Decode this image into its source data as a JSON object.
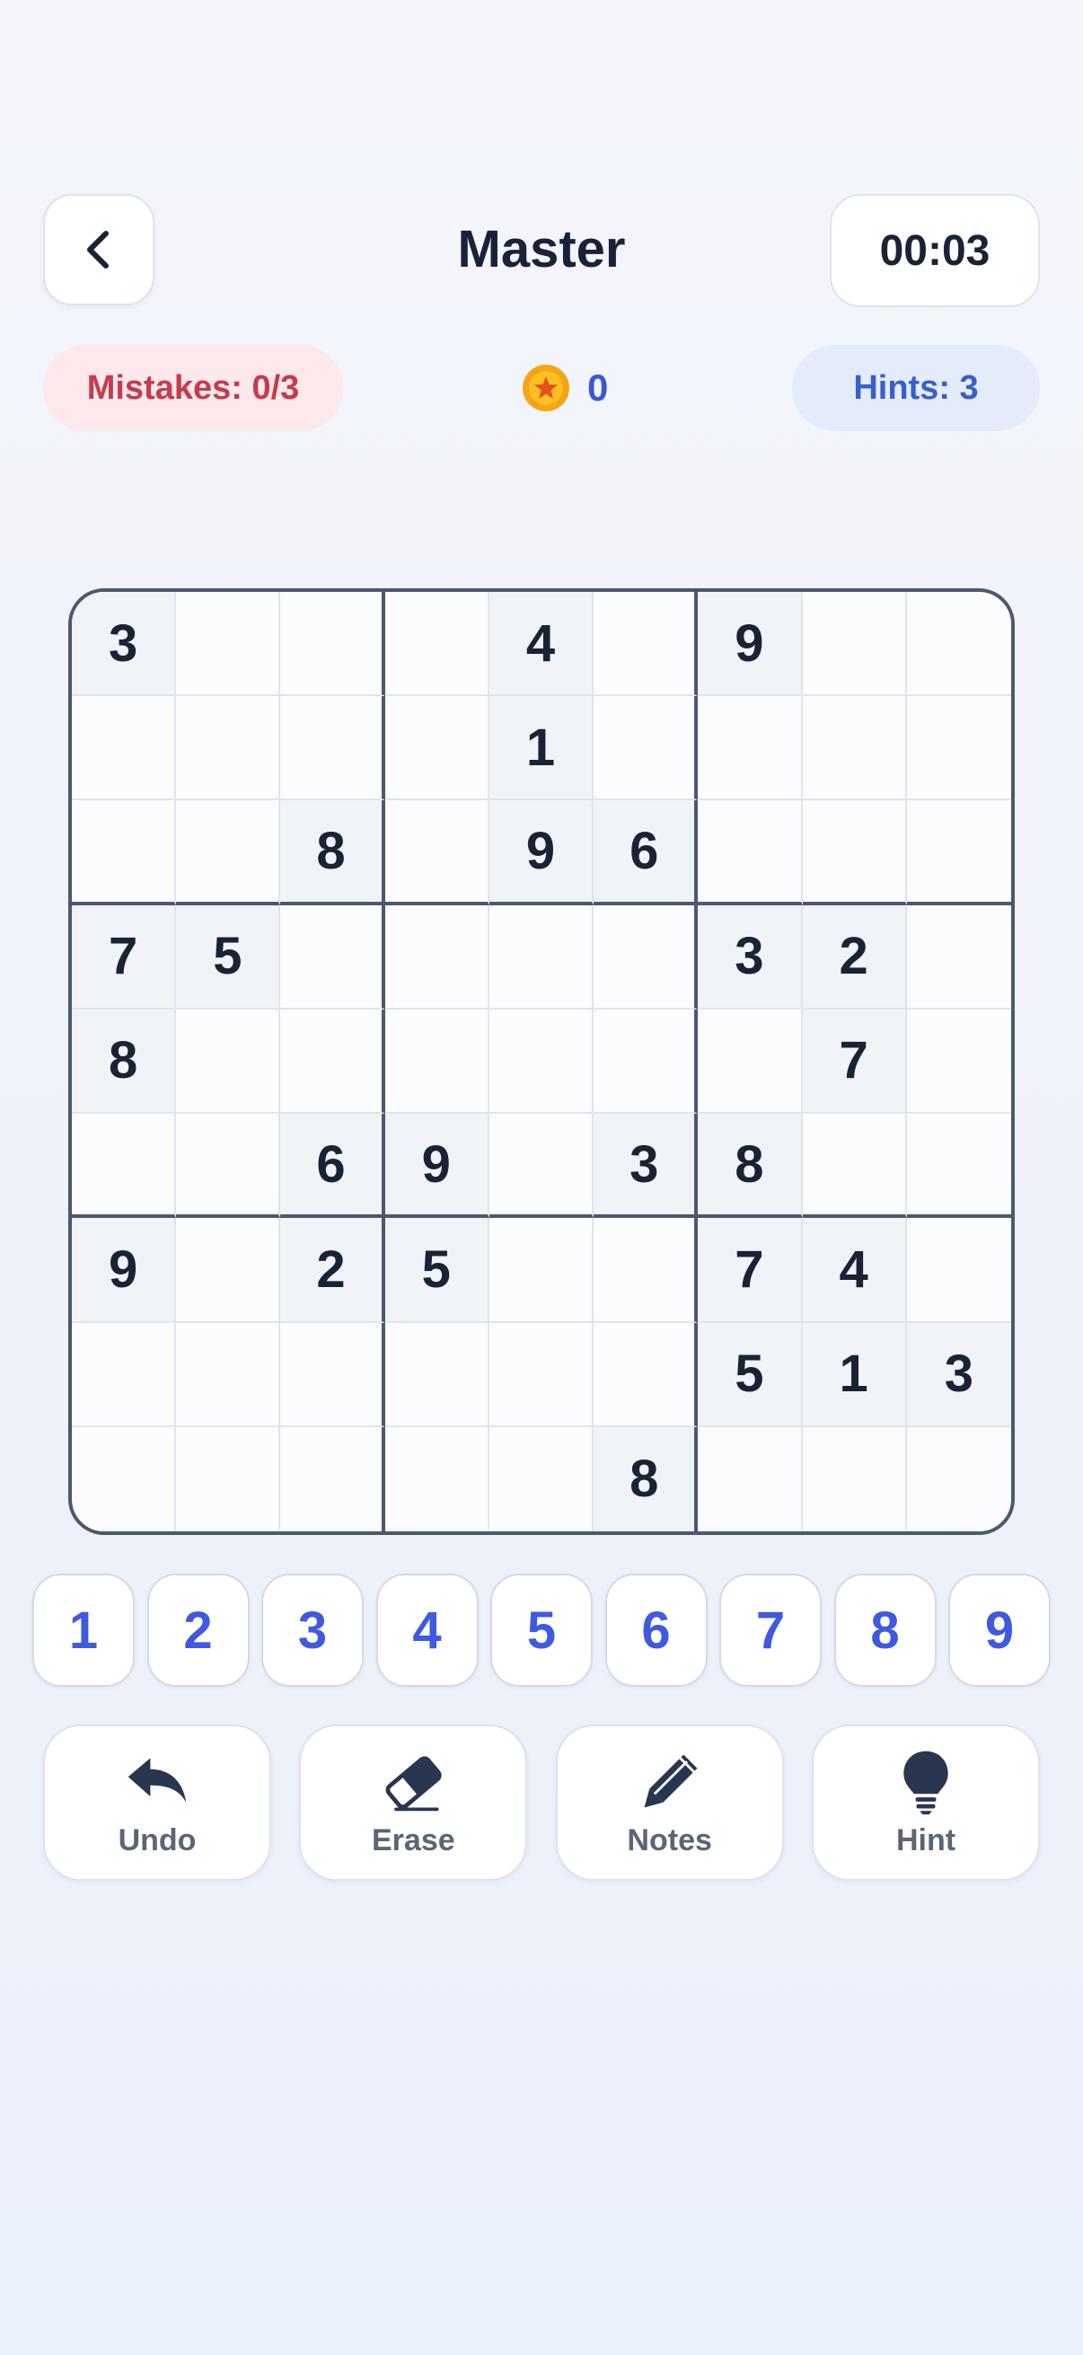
{
  "header": {
    "title": "Master",
    "timer": "00:03"
  },
  "status": {
    "mistakes": "Mistakes: 0/3",
    "coins": "0",
    "hints": "Hints: 3"
  },
  "colors": {
    "accent": "#3f5ae0",
    "mistakes_text": "#c83a4e",
    "mistakes_bg": "#fde8ec",
    "hints_bg": "#e4ecfb",
    "coin": "#f5a515"
  },
  "board": [
    [
      "3",
      "",
      "",
      "",
      "4",
      "",
      "9",
      "",
      ""
    ],
    [
      "",
      "",
      "",
      "",
      "1",
      "",
      "",
      "",
      ""
    ],
    [
      "",
      "",
      "8",
      "",
      "9",
      "6",
      "",
      "",
      ""
    ],
    [
      "7",
      "5",
      "",
      "",
      "",
      "",
      "3",
      "2",
      ""
    ],
    [
      "8",
      "",
      "",
      "",
      "",
      "",
      "",
      "7",
      ""
    ],
    [
      "",
      "",
      "6",
      "9",
      "",
      "3",
      "8",
      "",
      ""
    ],
    [
      "9",
      "",
      "2",
      "5",
      "",
      "",
      "7",
      "4",
      ""
    ],
    [
      "",
      "",
      "",
      "",
      "",
      "",
      "5",
      "1",
      "3"
    ],
    [
      "",
      "",
      "",
      "",
      "",
      "8",
      "",
      "",
      ""
    ]
  ],
  "numpad": [
    "1",
    "2",
    "3",
    "4",
    "5",
    "6",
    "7",
    "8",
    "9"
  ],
  "actions": [
    {
      "label": "Undo",
      "icon": "undo-icon"
    },
    {
      "label": "Erase",
      "icon": "eraser-icon"
    },
    {
      "label": "Notes",
      "icon": "pencil-icon"
    },
    {
      "label": "Hint",
      "icon": "lightbulb-icon"
    }
  ]
}
